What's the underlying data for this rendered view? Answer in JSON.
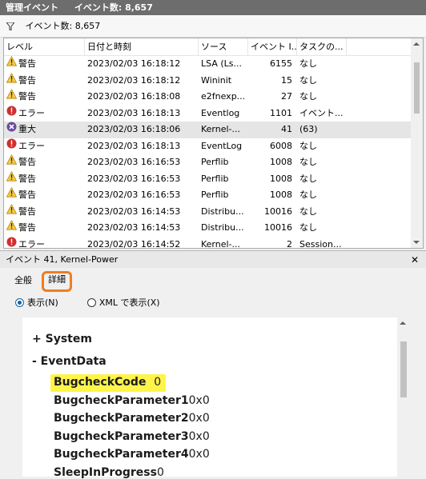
{
  "titlebar": {
    "title": "管理イベント",
    "count_label": "イベント数: 8,657"
  },
  "filterbar": {
    "label": "イベント数: 8,657"
  },
  "table": {
    "headers": [
      "レベル",
      "日付と時刻",
      "ソース",
      "イベント I...",
      "タスクの..."
    ],
    "rows": [
      {
        "level": "警告",
        "icon": "warning",
        "datetime": "2023/02/03 16:18:12",
        "source": "LSA (Ls...",
        "id": "6155",
        "task": "なし"
      },
      {
        "level": "警告",
        "icon": "warning",
        "datetime": "2023/02/03 16:18:12",
        "source": "Wininit",
        "id": "15",
        "task": "なし"
      },
      {
        "level": "警告",
        "icon": "warning",
        "datetime": "2023/02/03 16:18:08",
        "source": "e2fnexp...",
        "id": "27",
        "task": "なし"
      },
      {
        "level": "エラー",
        "icon": "error",
        "datetime": "2023/02/03 16:18:13",
        "source": "Eventlog",
        "id": "1101",
        "task": "イベント..."
      },
      {
        "level": "重大",
        "icon": "critical",
        "datetime": "2023/02/03 16:18:06",
        "source": "Kernel-...",
        "id": "41",
        "task": "(63)",
        "selected": true
      },
      {
        "level": "エラー",
        "icon": "error",
        "datetime": "2023/02/03 16:18:13",
        "source": "EventLog",
        "id": "6008",
        "task": "なし"
      },
      {
        "level": "警告",
        "icon": "warning",
        "datetime": "2023/02/03 16:16:53",
        "source": "Perflib",
        "id": "1008",
        "task": "なし"
      },
      {
        "level": "警告",
        "icon": "warning",
        "datetime": "2023/02/03 16:16:53",
        "source": "Perflib",
        "id": "1008",
        "task": "なし"
      },
      {
        "level": "警告",
        "icon": "warning",
        "datetime": "2023/02/03 16:16:53",
        "source": "Perflib",
        "id": "1008",
        "task": "なし"
      },
      {
        "level": "警告",
        "icon": "warning",
        "datetime": "2023/02/03 16:14:53",
        "source": "Distribu...",
        "id": "10016",
        "task": "なし"
      },
      {
        "level": "警告",
        "icon": "warning",
        "datetime": "2023/02/03 16:14:53",
        "source": "Distribu...",
        "id": "10016",
        "task": "なし"
      },
      {
        "level": "エラー",
        "icon": "error",
        "datetime": "2023/02/03 16:14:52",
        "source": "Kernel-...",
        "id": "2",
        "task": "Session..."
      }
    ]
  },
  "detail": {
    "title": "イベント 41, Kernel-Power",
    "close": "✕",
    "tabs": [
      "全般",
      "詳細"
    ],
    "radio_view": "表示(N)",
    "radio_xml": "XML で表示(X)",
    "xml": {
      "system": "+  System",
      "eventdata": "-   EventData",
      "fields": [
        {
          "name": "BugcheckCode",
          "value": "0"
        },
        {
          "name": "BugcheckParameter1",
          "value": "0x0"
        },
        {
          "name": "BugcheckParameter2",
          "value": "0x0"
        },
        {
          "name": "BugcheckParameter3",
          "value": "0x0"
        },
        {
          "name": "BugcheckParameter4",
          "value": "0x0"
        },
        {
          "name": "SleepInProgress",
          "value": "0"
        }
      ]
    }
  },
  "colors": {
    "highlight": "#fff44a",
    "tab_outline": "#ef7d22",
    "titlebar": "#6d6d6d"
  }
}
